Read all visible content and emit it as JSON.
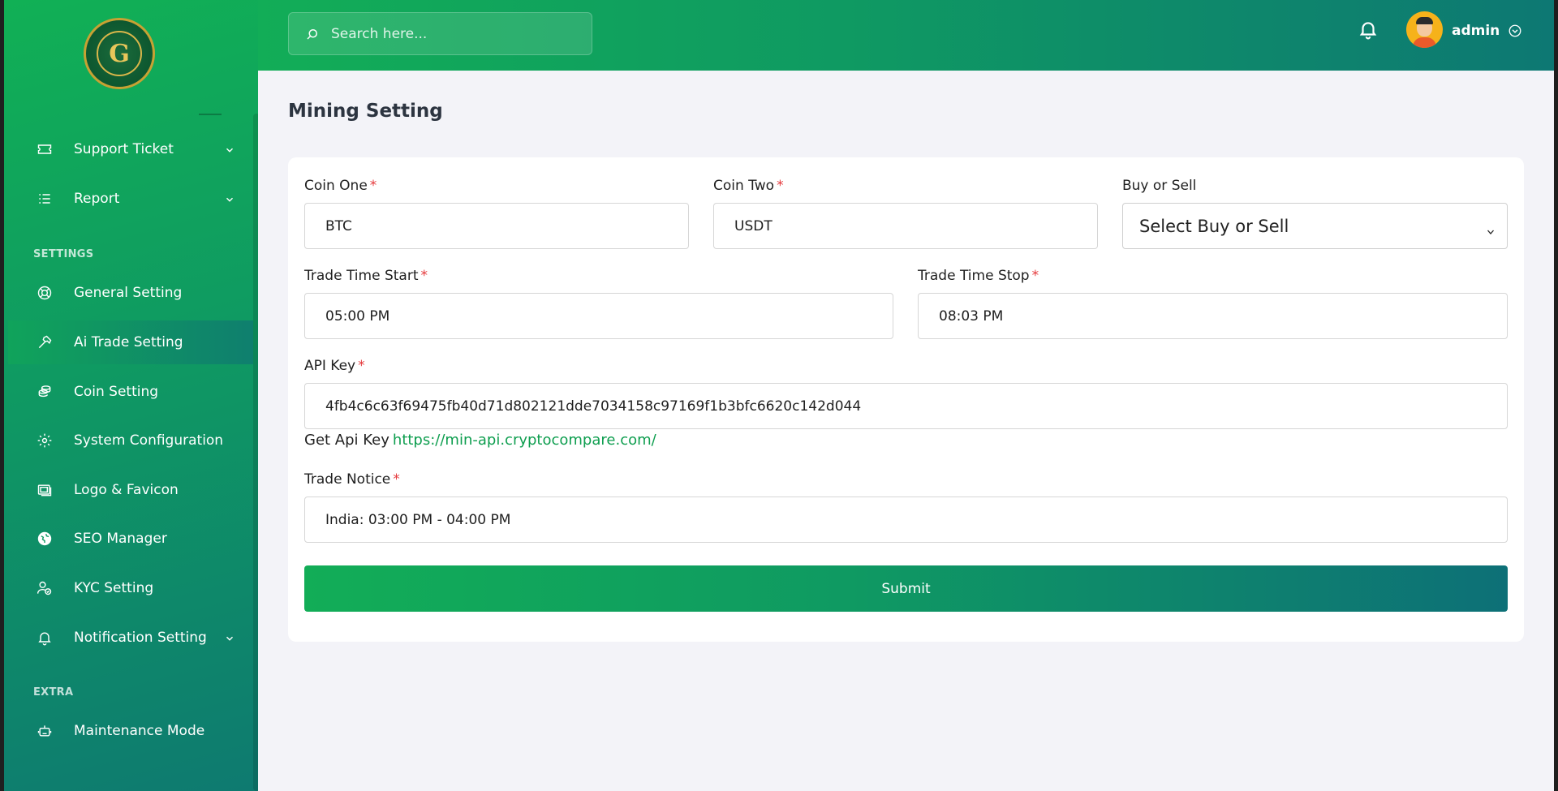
{
  "header": {
    "search_placeholder": "Search here...",
    "user_name": "admin"
  },
  "sidebar": {
    "items_top": [
      {
        "label": "Support Ticket",
        "icon": "ticket-icon",
        "has_children": true
      },
      {
        "label": "Report",
        "icon": "list-icon",
        "has_children": true
      }
    ],
    "section_settings": "SETTINGS",
    "settings_items": [
      {
        "label": "General Setting",
        "icon": "lifebuoy-icon"
      },
      {
        "label": "Ai Trade Setting",
        "icon": "hammer-icon",
        "active": true
      },
      {
        "label": "Coin Setting",
        "icon": "coins-icon"
      },
      {
        "label": "System Configuration",
        "icon": "gear-icon"
      },
      {
        "label": "Logo & Favicon",
        "icon": "images-icon"
      },
      {
        "label": "SEO Manager",
        "icon": "globe-icon"
      },
      {
        "label": "KYC Setting",
        "icon": "user-check-icon"
      },
      {
        "label": "Notification Setting",
        "icon": "bell-icon",
        "has_children": true
      }
    ],
    "section_extra": "EXTRA",
    "extra_items": [
      {
        "label": "Maintenance Mode",
        "icon": "robot-icon"
      }
    ]
  },
  "main": {
    "title": "Mining Setting",
    "form": {
      "coin_one": {
        "label": "Coin One",
        "value": "BTC",
        "required": "*"
      },
      "coin_two": {
        "label": "Coin Two",
        "value": "USDT",
        "required": "*"
      },
      "buy_or_sell": {
        "label": "Buy or Sell",
        "selected": "Select Buy or Sell"
      },
      "trade_time_start": {
        "label": "Trade Time Start",
        "value": "05:00 PM",
        "required": "*"
      },
      "trade_time_stop": {
        "label": "Trade Time Stop",
        "value": "08:03 PM",
        "required": "*"
      },
      "api_key": {
        "label": "API Key",
        "value": "4fb4c6c63f69475fb40d71d802121dde7034158c97169f1b3bfc6620c142d044",
        "required": "*"
      },
      "api_help_text": "Get Api Key",
      "api_help_link": "https://min-api.cryptocompare.com/",
      "trade_notice": {
        "label": "Trade Notice",
        "value": "India: 03:00 PM - 04:00 PM",
        "required": "*"
      },
      "submit_label": "Submit"
    }
  },
  "colors": {
    "accent_green": "#12ad57",
    "accent_teal": "#0d7077",
    "required_red": "#e5383b",
    "link_green": "#0e9e4f"
  }
}
